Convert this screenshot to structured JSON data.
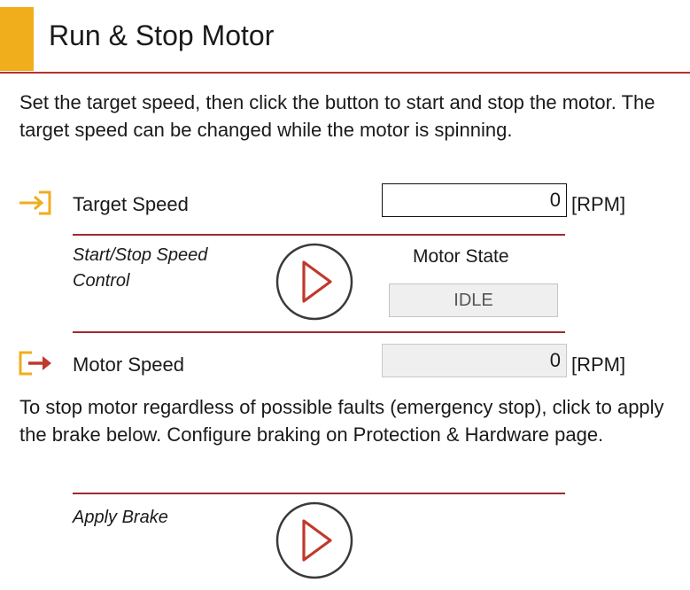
{
  "header": {
    "title": "Run & Stop Motor"
  },
  "intro_text": "Set the target speed, then click the button to start and stop the motor. The target speed can be changed while the motor is spinning.",
  "target_speed": {
    "label": "Target Speed",
    "value": "0",
    "unit": "[RPM]",
    "icon": "input-arrow-icon"
  },
  "start_stop": {
    "label_line1": "Start/Stop Speed",
    "label_line2": "Control",
    "icon": "play-icon",
    "motor_state_label": "Motor State",
    "motor_state_value": "IDLE"
  },
  "motor_speed": {
    "label": "Motor Speed",
    "value": "0",
    "unit": "[RPM]",
    "icon": "output-arrow-icon"
  },
  "brake_text": "To stop motor regardless of possible faults (emergency stop), click to apply the brake below. Configure braking on Protection & Hardware page.",
  "brake": {
    "label": "Apply Brake",
    "icon": "play-icon"
  },
  "colors": {
    "accent": "#f0ad1c",
    "rule": "#b4312c",
    "play": "#c0392b",
    "output_arrow": "#c0392b"
  }
}
